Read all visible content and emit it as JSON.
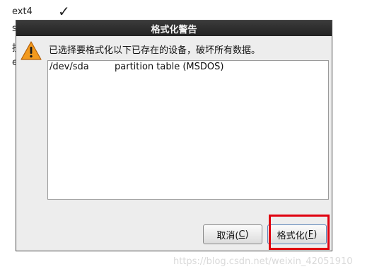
{
  "background": {
    "fs_label": "ext4",
    "check_icon": "checkmark",
    "cut_labels": [
      "s",
      "抗",
      "e"
    ]
  },
  "dialog": {
    "title": "格式化警告",
    "warning_icon": "warning-triangle",
    "message": "已选择要格式化以下已存在的设备，破坏所有数据。",
    "devices": [
      {
        "device": "/dev/sda",
        "description": "partition table (MSDOS)"
      }
    ],
    "buttons": {
      "cancel": {
        "text": "取消(",
        "mnemonic": "C",
        "suffix": ")"
      },
      "format": {
        "text": "格式化(",
        "mnemonic": "F",
        "suffix": ")"
      }
    }
  },
  "annotation": {
    "highlight_color": "#e0000f"
  },
  "watermark": "https://blog.csdn.net/weixin_42051910"
}
